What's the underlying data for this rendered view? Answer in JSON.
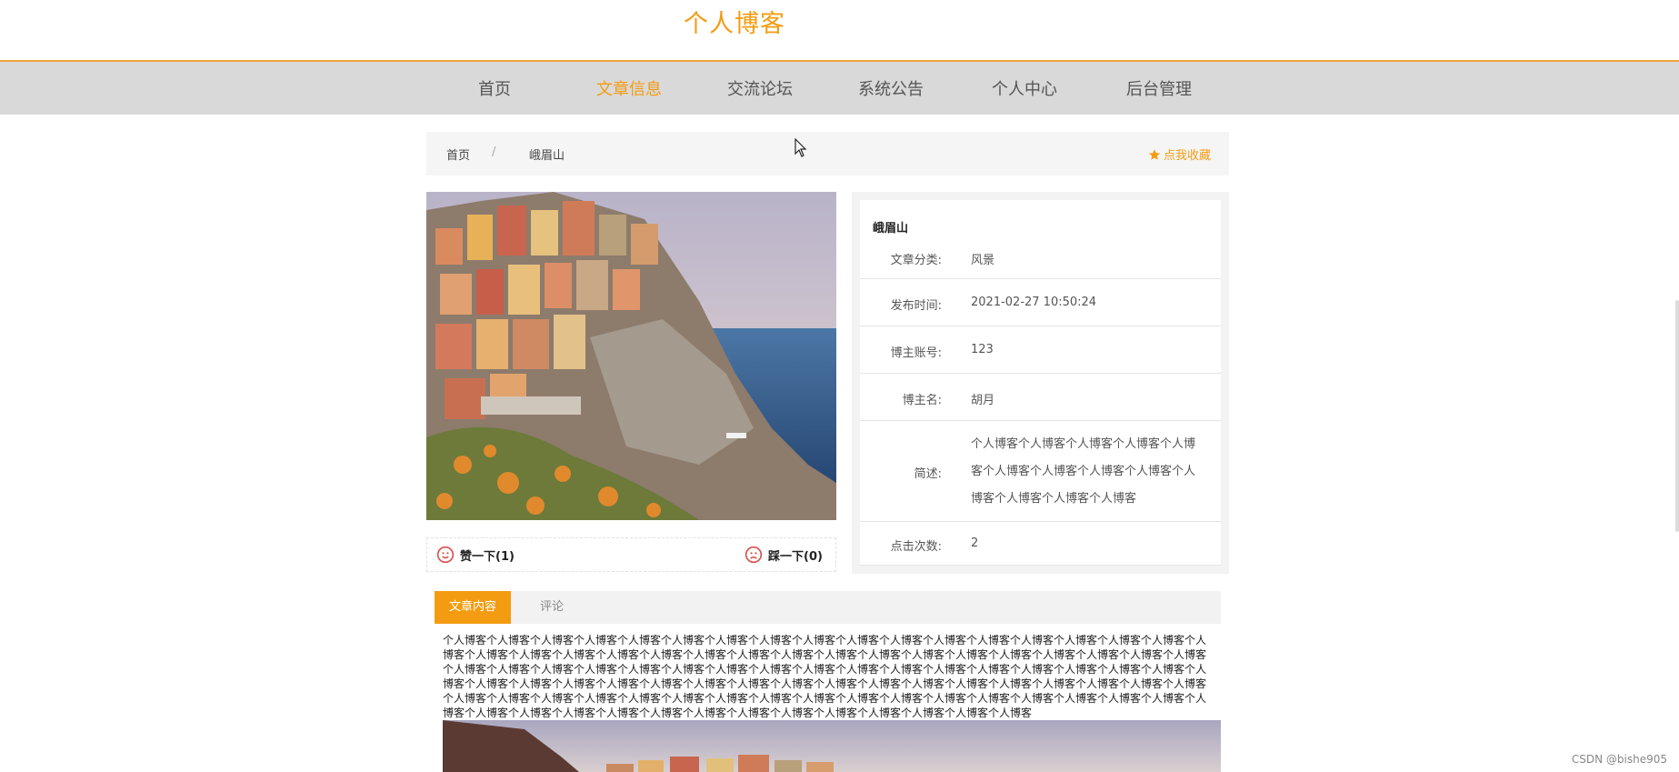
{
  "site": {
    "title": "个人博客"
  },
  "nav": {
    "items": [
      "首页",
      "文章信息",
      "交流论坛",
      "系统公告",
      "个人中心",
      "后台管理"
    ],
    "active": "文章信息"
  },
  "breadcrumb": {
    "home": "首页",
    "separator": "/",
    "current": "峨眉山",
    "favorite_label": "点我收藏",
    "favorite_icon": "star-icon"
  },
  "votes": {
    "like_label": "赞一下(1)",
    "dislike_label": "踩一下(0)",
    "like_icon": "smile-icon",
    "dislike_icon": "frown-icon"
  },
  "info": {
    "title": "峨眉山",
    "category_label": "文章分类:",
    "category_value": "风景",
    "publish_label": "发布时间:",
    "publish_value": "2021-02-27 10:50:24",
    "account_label": "博主账号:",
    "account_value": "123",
    "author_label": "博主名:",
    "author_value": "胡月",
    "desc_label": "简述:",
    "desc_value": "个人博客个人博客个人博客个人博客个人博客个人博客个人博客个人博客个人博客个人博客个人博客个人博客个人博客",
    "clicks_label": "点击次数:",
    "clicks_value": "2"
  },
  "tabs": {
    "content": "文章内容",
    "comments": "评论"
  },
  "article": {
    "text": "个人博客个人博客个人博客个人博客个人博客个人博客个人博客个人博客个人博客个人博客个人博客个人博客个人博客个人博客个人博客个人博客个人博客个人博客个人博客个人博客个人博客个人博客个人博客个人博客个人博客个人博客个人博客个人博客个人博客个人博客个人博客个人博客个人博客个人博客个人博客个人博客个人博客个人博客个人博客个人博客个人博客个人博客个人博客个人博客个人博客个人博客个人博客个人博客个人博客个人博客个人博客个人博客个人博客个人博客个人博客个人博客个人博客个人博客个人博客个人博客个人博客个人博客个人博客个人博客个人博客个人博客个人博客个人博客个人博客个人博客个人博客个人博客个人博客个人博客个人博客个人博客个人博客个人博客个人博客个人博客个人博客个人博客个人博客个人博客个人博客个人博客个人博客个人博客个人博客个人博客个人博客个人博客个人博客个人博客个人博客个人博客个人博客个人博客个人博客个人博客个人博客"
  },
  "watermark": "CSDN @bishe905",
  "colors": {
    "accent": "#f39c12",
    "nav_bg": "#d9d9d9"
  }
}
